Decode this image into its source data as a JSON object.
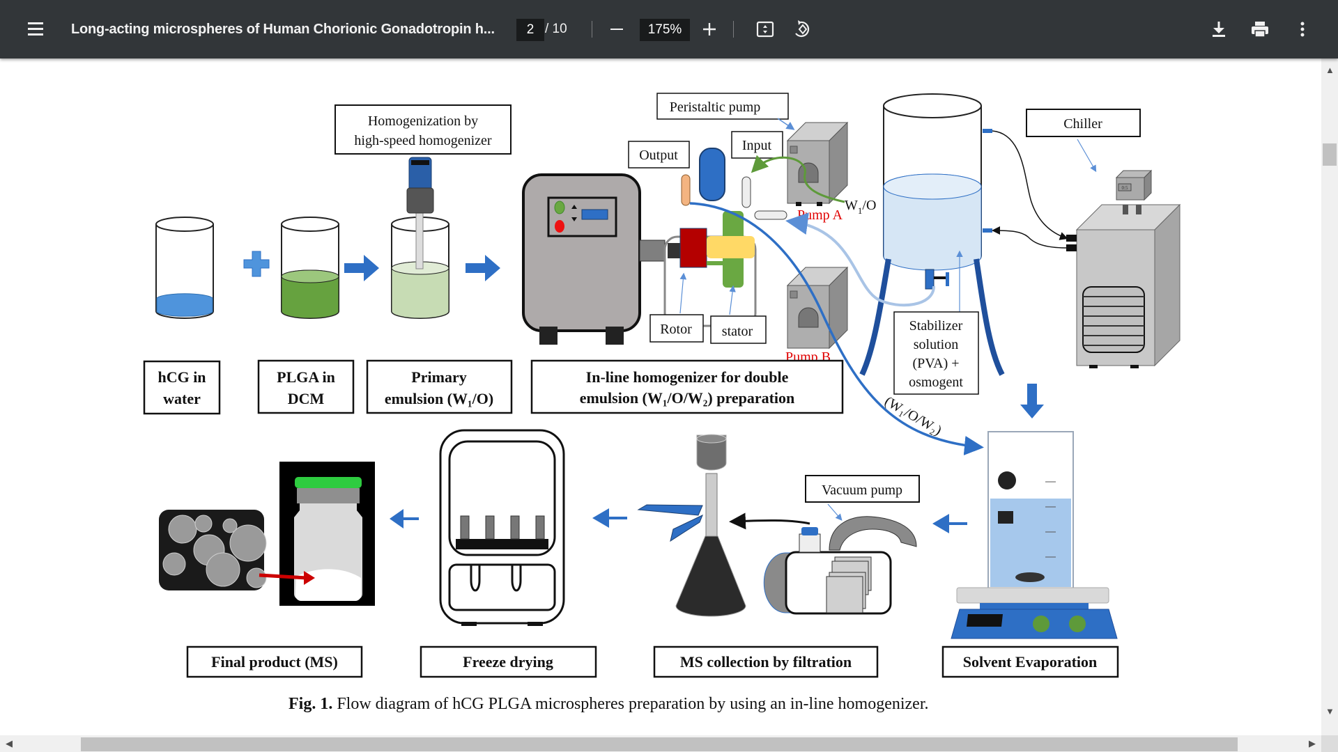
{
  "toolbar": {
    "title": "Long-acting microspheres of Human Chorionic Gonadotropin h...",
    "current_page": "2",
    "page_total": "/ 10",
    "zoom": "175%",
    "icons": {
      "menu": "hamburger-menu-icon",
      "zoom_out": "minus-icon",
      "zoom_in": "plus-icon",
      "fit": "fit-to-page-icon",
      "rotate": "rotate-counterclockwise-icon",
      "download": "download-icon",
      "print": "print-icon",
      "more": "more-vertical-icon"
    },
    "glyphs": {
      "zoom_out": "—",
      "zoom_in": "+",
      "more": "⋮"
    }
  },
  "figure": {
    "labels": {
      "homogenization": [
        "Homogenization by",
        "high-speed homogenizer"
      ],
      "peristaltic_pump": "Peristaltic pump",
      "output": "Output",
      "input": "Input",
      "w1o": "W",
      "w1o_sub": "1",
      "w1o_rest": "/O",
      "pump_a": "Pump A",
      "pump_b": "Pump B",
      "rotor": "Rotor",
      "stator": "stator",
      "chiller": "Chiller",
      "chiller_display": "0:5",
      "stabilizer": [
        "Stabilizer",
        "solution",
        "(PVA) +",
        "osmogent"
      ],
      "w1ow2_curve": "(W₁/O/W₂)",
      "vacuum_pump": "Vacuum pump"
    },
    "steps_top": [
      {
        "lines": [
          "hCG in",
          "water"
        ]
      },
      {
        "lines": [
          "PLGA in",
          "DCM"
        ]
      },
      {
        "lines": [
          "Primary",
          "emulsion (W₁/O)"
        ]
      },
      {
        "lines": [
          "In-line homogenizer for double",
          "emulsion (W₁/O/W₂) preparation"
        ]
      }
    ],
    "steps_bottom": [
      "Final product (MS)",
      "Freeze drying",
      "MS collection by filtration",
      "Solvent Evaporation"
    ],
    "caption_prefix": "Fig. 1.",
    "caption_text": "Flow diagram of hCG PLGA microspheres preparation by using an in-line homogenizer.",
    "colors": {
      "arrow_blue": "#2e6fc5",
      "liquid_blue": "#4f94dc",
      "plga_green": "#66a23f",
      "emulsion_green": "#c7dcb4",
      "pump_red": "#e00000",
      "rotor_red": "#b40000",
      "stator_green": "#6aa842",
      "yellow": "#ffd966",
      "tank_liquid": "#d6e6f5",
      "stand_blue": "#1f4f9c"
    }
  }
}
